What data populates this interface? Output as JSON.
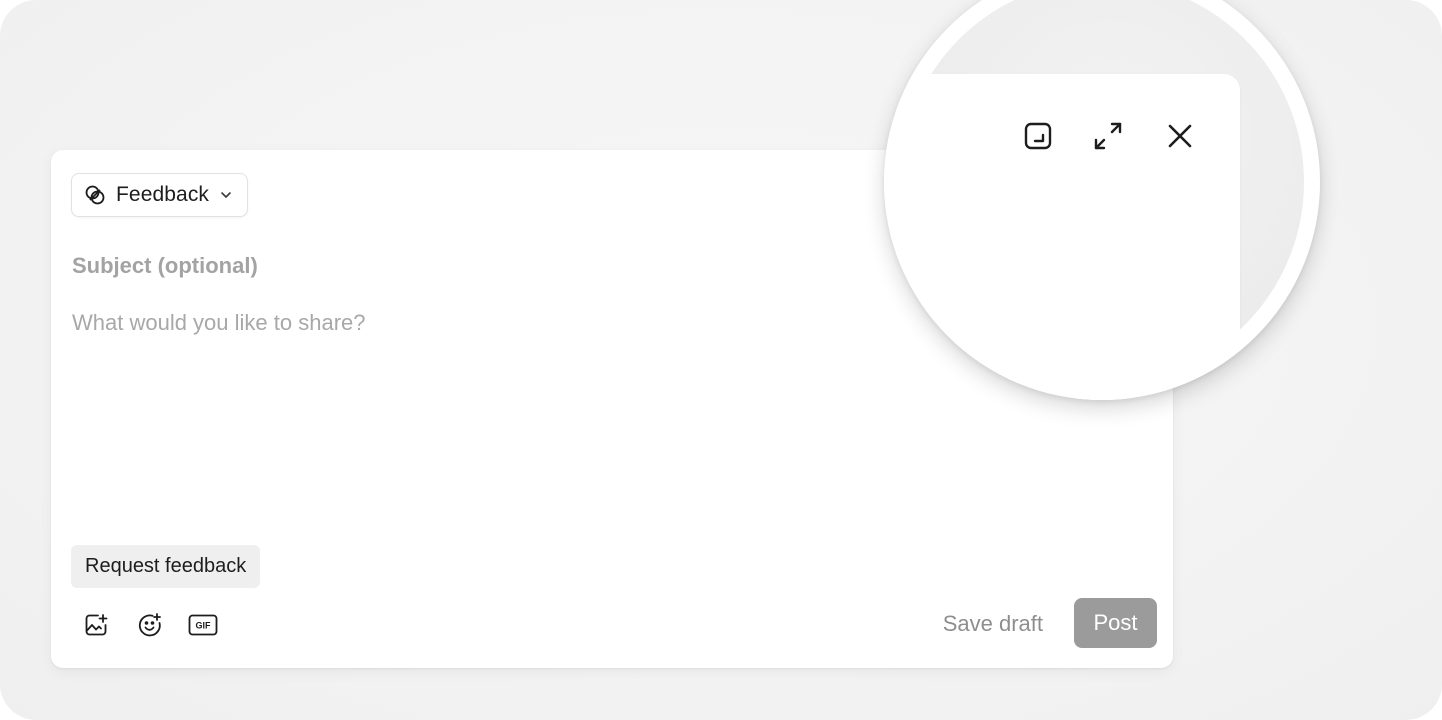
{
  "composer": {
    "type_selector": {
      "label": "Feedback",
      "icon": "feedback-circles-icon",
      "chevron_icon": "chevron-down-icon"
    },
    "subject": {
      "placeholder": "Subject (optional)",
      "value": ""
    },
    "body": {
      "placeholder": "What would you like to share?",
      "value": ""
    },
    "request_feedback_label": "Request feedback",
    "toolbar": {
      "tools": [
        {
          "name": "add-image-icon"
        },
        {
          "name": "add-emoji-icon"
        },
        {
          "name": "gif-icon",
          "label": "GIF"
        }
      ]
    },
    "save_draft_label": "Save draft",
    "post_label": "Post"
  },
  "window_controls": {
    "icons": [
      "minimize-window-icon",
      "expand-icon",
      "close-icon"
    ]
  },
  "colors": {
    "post_button_disabled": "#9b9b9b",
    "placeholder_text": "#a3a3a3",
    "background": "#f3f3f3"
  }
}
